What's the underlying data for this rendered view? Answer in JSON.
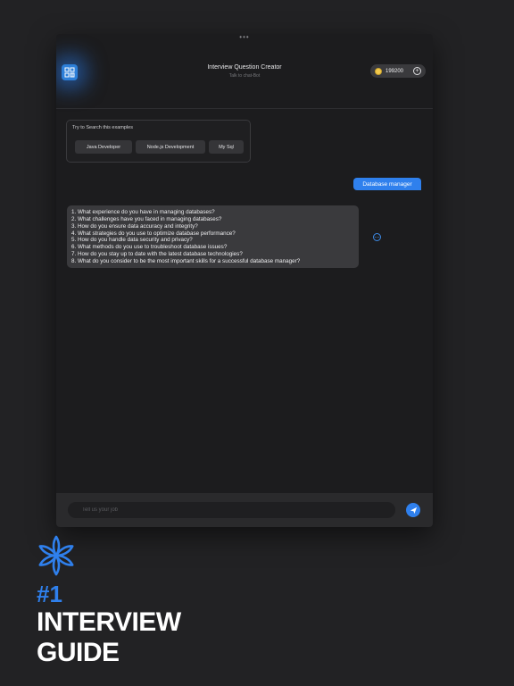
{
  "app": {
    "title": "Interview Question Creator",
    "subtitle": "Talk to chat-Bot",
    "coins": "199200"
  },
  "examples": {
    "title": "Try to Search this examples",
    "chips": [
      "Java Developer",
      "Node.js Development",
      "My Sql"
    ]
  },
  "chat": {
    "user_message": "Database manager",
    "bot_lines": [
      "1. What experience do you have in managing databases?",
      "2. What challenges have you faced in managing databases?",
      "3. How do you ensure data accuracy and integrity?",
      "4. What strategies do you use to optimize database performance?",
      "5. How do you handle data security and privacy?",
      "6. What methods do you use to troubleshoot database issues?",
      "7. How do you stay up to date with the latest database technologies?",
      "8. What do you consider to be the most important skills for a successful database manager?"
    ]
  },
  "composer": {
    "placeholder": "Tell us your job"
  },
  "promo": {
    "number": "#1",
    "line1": "INTERVIEW",
    "line2": "GUIDE"
  },
  "colors": {
    "accent": "#2f80ed",
    "background": "#222224",
    "bubble": "#3a3a3d",
    "coin": "#f2c94c"
  }
}
